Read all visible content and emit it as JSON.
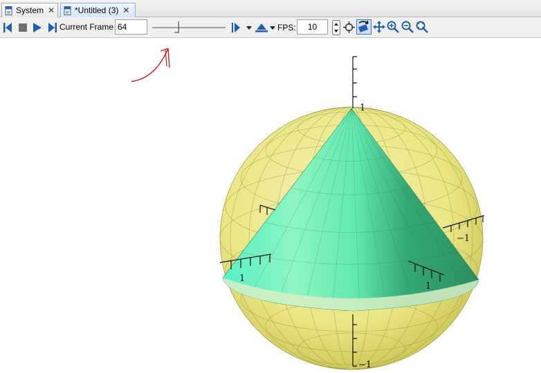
{
  "tabs": [
    {
      "label": "System",
      "icon": "worksheet-icon",
      "active": false
    },
    {
      "label": "*Untitled (3)",
      "icon": "worksheet-icon",
      "active": true
    }
  ],
  "tab_close_glyph": "✕",
  "toolbar": {
    "current_frame_label": "Current Frame",
    "current_frame_value": "64",
    "fps_label": "FPS:",
    "fps_value": "10",
    "slider_position": 0.36
  },
  "plot": {
    "axis_labels": {
      "z_top": "1",
      "z_bottom": "−1",
      "x_front": "1",
      "y_front": "1",
      "y_back": "−1"
    }
  },
  "colors": {
    "sphere": "#e3df5e",
    "cone_light": "#69f0c2",
    "cone_dark": "#2f9a69",
    "annotation": "#d11a1a",
    "icon_blue": "#1f5fb3"
  }
}
